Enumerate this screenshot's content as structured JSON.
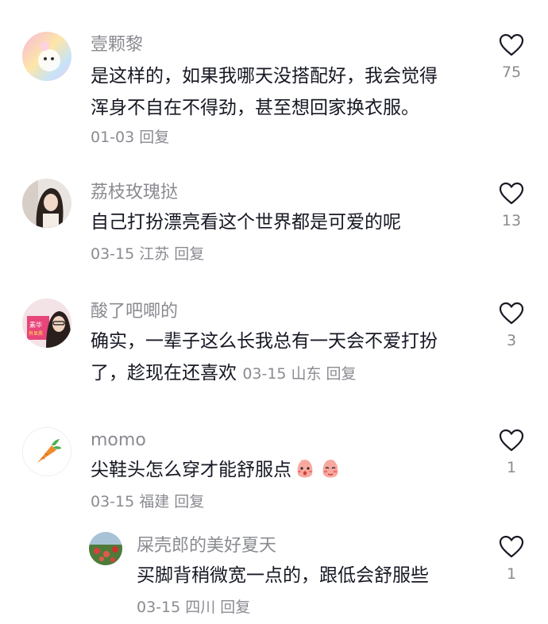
{
  "comments": [
    {
      "username": "壹颗黎",
      "text_lines": [
        "是这样的，如果我哪天没搭配好，我会觉得",
        "浑身不自在不得劲，甚至想回家换衣服。"
      ],
      "date": "01-03",
      "location": "",
      "reply_label": "回复",
      "likes": "75"
    },
    {
      "username": "荔枝玫瑰挞",
      "text_lines": [
        "自己打扮漂亮看这个世界都是可爱的呢"
      ],
      "date": "03-15",
      "location": "江苏",
      "reply_label": "回复",
      "likes": "13"
    },
    {
      "username": "酸了吧唧的",
      "text_lines": [
        "确实，一辈子这么长我总有一天会不爱打扮",
        "了，趁现在还喜欢"
      ],
      "date": "03-15",
      "location": "山东",
      "reply_label": "回复",
      "likes": "3"
    },
    {
      "username": "momo",
      "text_lines": [
        "尖鞋头怎么穿才能舒服点"
      ],
      "emoji": [
        "blush-emoji",
        "shy-emoji"
      ],
      "date": "03-15",
      "location": "福建",
      "reply_label": "回复",
      "likes": "1"
    },
    {
      "username": "屎壳郎的美好夏天",
      "text_lines": [
        "买脚背稍微宽一点的，跟低会舒服些"
      ],
      "date": "03-15",
      "location": "四川",
      "reply_label": "回复",
      "likes": "1"
    }
  ],
  "avatar_2_text": [
    "素华",
    "有显质"
  ],
  "icons": {
    "like": "heart-outline-icon",
    "avatar_momo": "carrot-icon"
  },
  "colors": {
    "text": "#161823",
    "muted": "#8a8b91"
  }
}
